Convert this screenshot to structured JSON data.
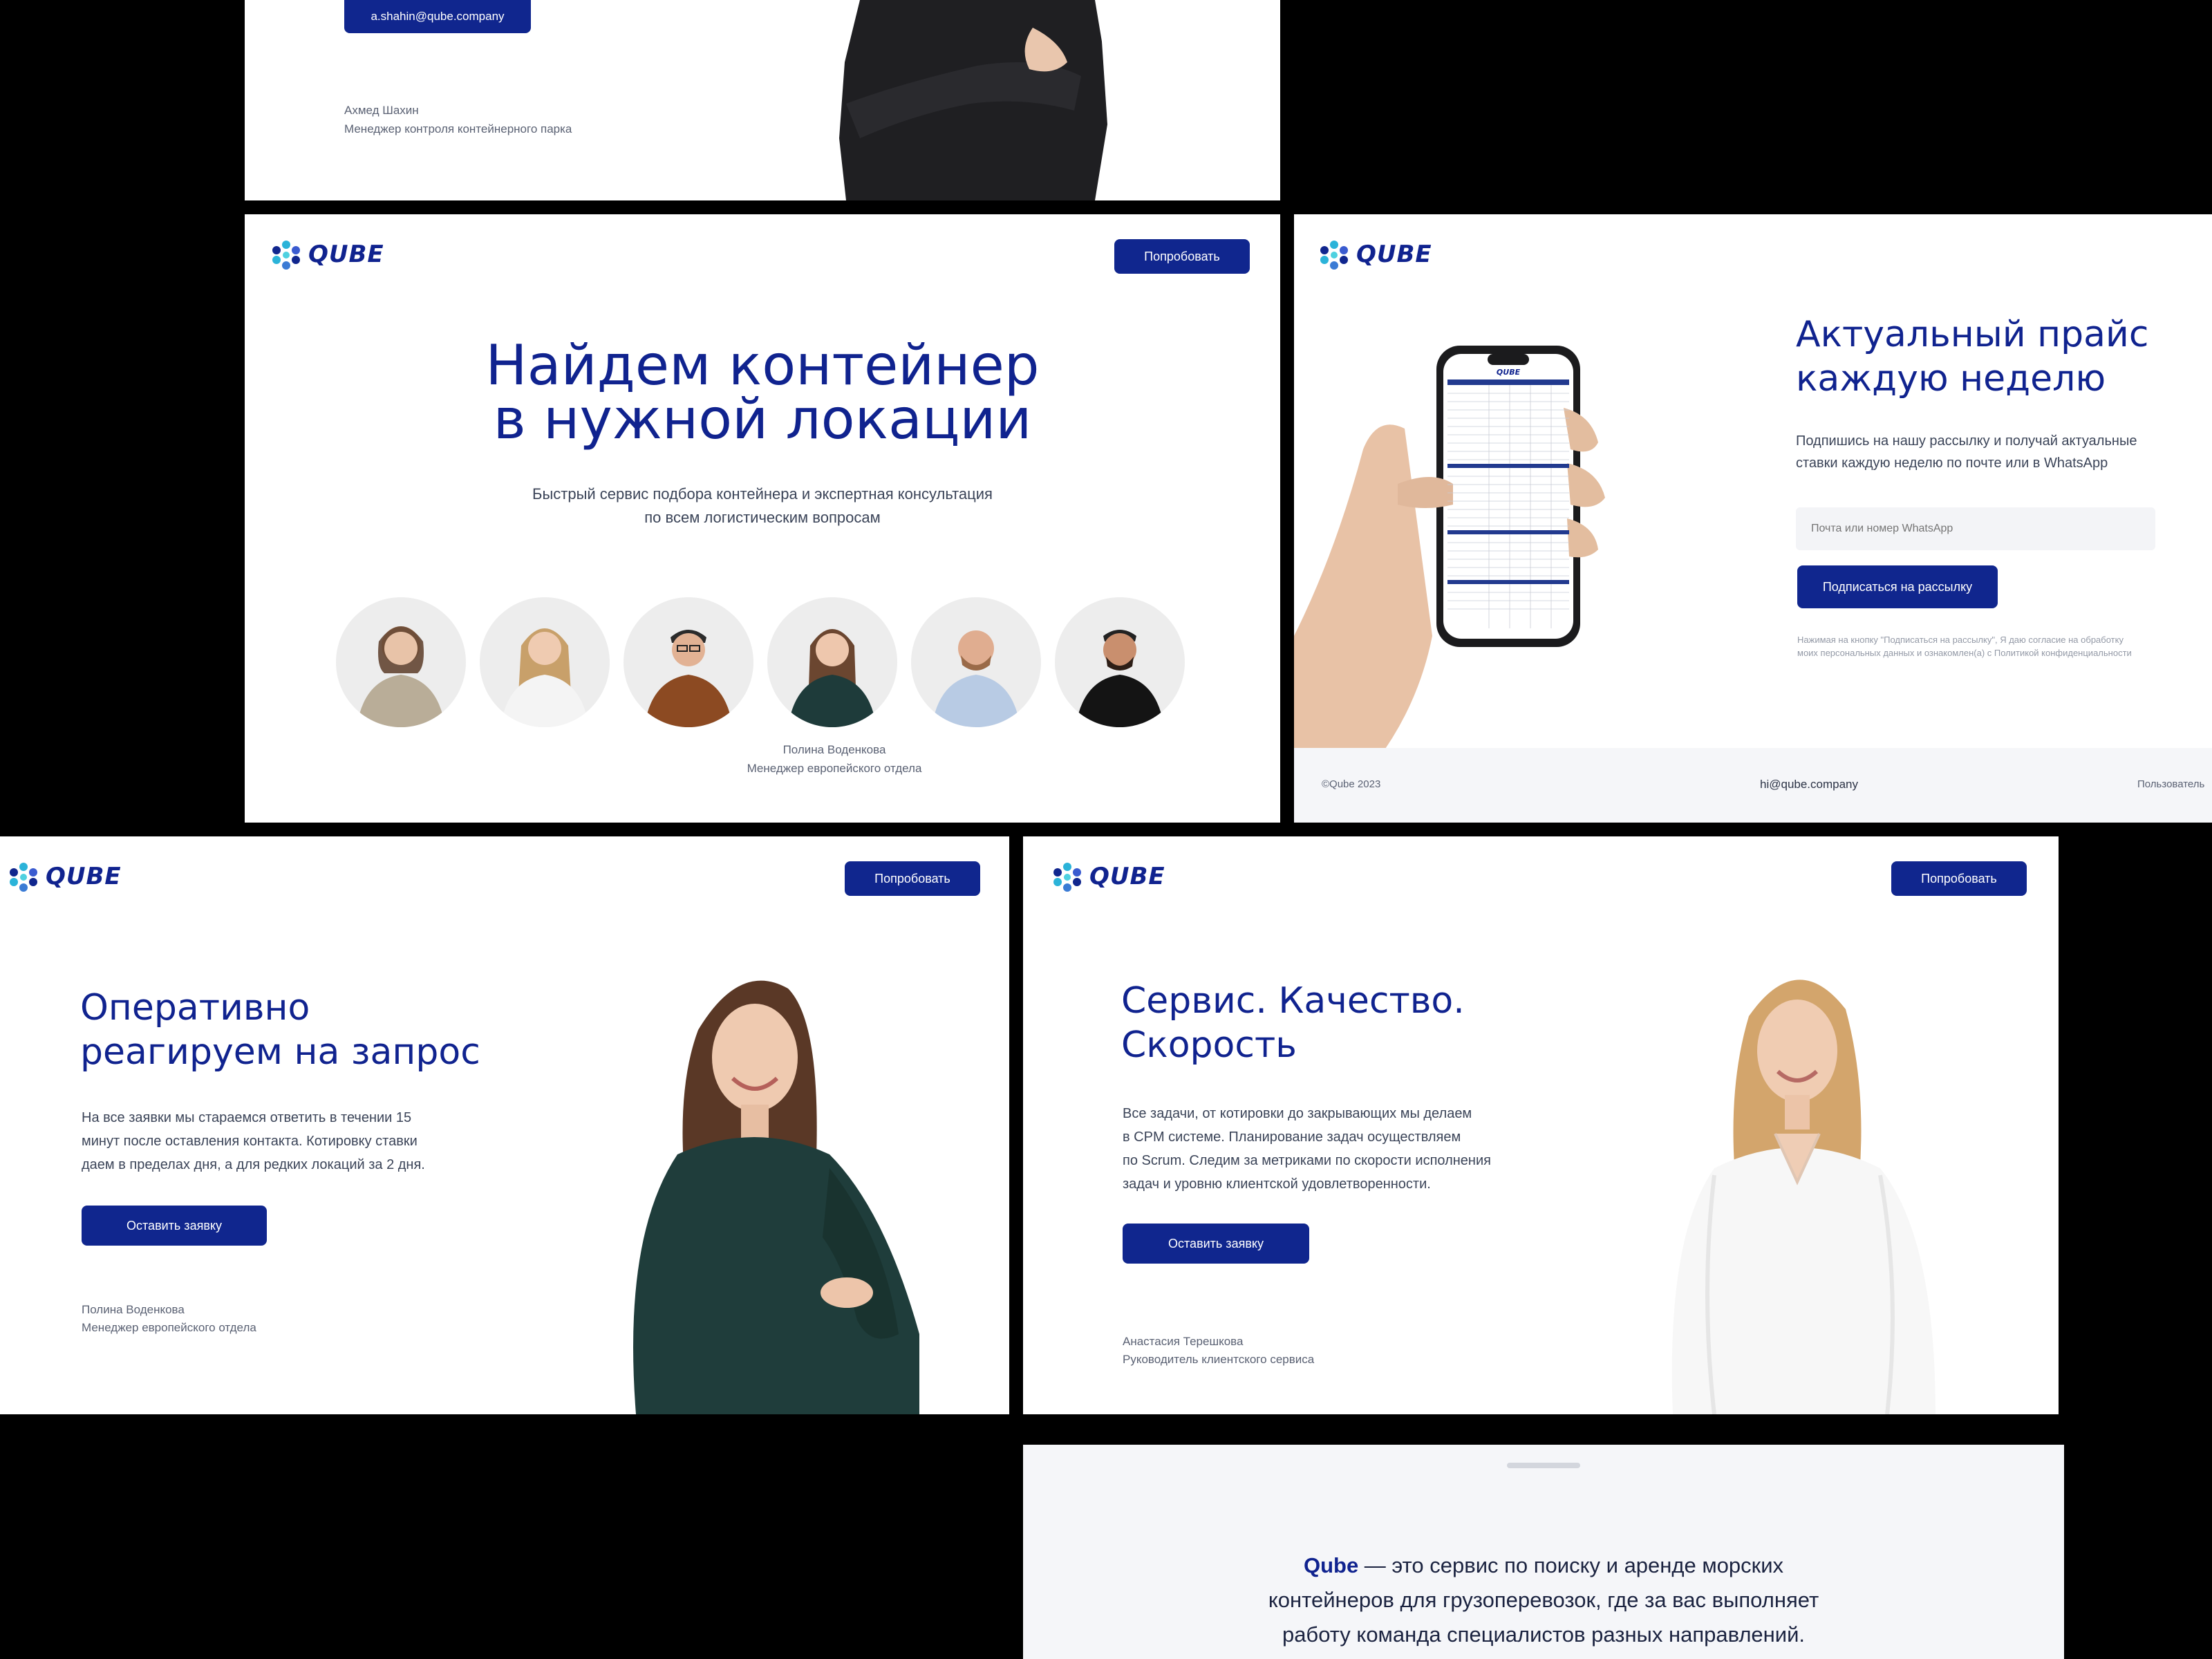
{
  "brand": {
    "name": "QUBE",
    "accent": "#10268e",
    "bg_light": "#f5f6f9"
  },
  "top_card": {
    "email_button": "a.shahin@qube.company",
    "person_name": "Ахмед Шахин",
    "person_role": "Менеджер контроля контейнерного парка"
  },
  "hero": {
    "cta": "Попробовать",
    "title_line1": "Найдем контейнер",
    "title_line2": "в нужной локации",
    "subtitle_line1": "Быстрый сервис подбора контейнера и экспертная консультация",
    "subtitle_line2": "по всем логистическим вопросам",
    "person_name": "Полина Воденкова",
    "person_role": "Менеджер европейского отдела",
    "avatars": [
      "beige",
      "white",
      "brown",
      "green",
      "blue",
      "black"
    ]
  },
  "newsletter": {
    "title_line1": "Актуальный прайс",
    "title_line2": "каждую неделю",
    "text_line1": "Подпишись на нашу рассылку и получай актуальные",
    "text_line2": "ставки каждую неделю по почте или в WhatsApp",
    "input_placeholder": "Почта или номер WhatsApp",
    "button": "Подписаться на рассылку",
    "consent_line1": "Нажимая на кнопку \"Подписаться на рассылку\", Я даю согласие на обработку",
    "consent_line2": "моих персональных данных и ознакомлен(а) с Политикой конфиденциальности",
    "footer_copy": "©Qube 2023",
    "footer_email": "hi@qube.company",
    "footer_link": "Пользователь",
    "phone_logo": "QUBE"
  },
  "fast": {
    "cta": "Попробовать",
    "title_line1": "Оперативно",
    "title_line2": "реагируем на запрос",
    "text_line1": "На все заявки мы стараемся ответить в течении 15",
    "text_line2": "минут после оставления контакта. Котировку ставки",
    "text_line3": "даем в пределах дня, а для редких локаций за 2 дня.",
    "button": "Оставить заявку",
    "person_name": "Полина Воденкова",
    "person_role": "Менеджер европейского отдела"
  },
  "service": {
    "cta": "Попробовать",
    "title_line1": "Сервис. Качество.",
    "title_line2": "Скорость",
    "text_line1": "Все задачи, от котировки до закрывающих мы делаем",
    "text_line2": "в CPM системе. Планирование задач осуществляем",
    "text_line3": "по Scrum. Следим за метриками по скорости исполнения",
    "text_line4": "задач и уровню клиентской удовлетворенности.",
    "button": "Оставить заявку",
    "person_name": "Анастасия Терешкова",
    "person_role": "Руководитель клиентского сервиса"
  },
  "about": {
    "brand_word": "Qube",
    "line1_rest": " — это сервис по поиску и аренде морских",
    "line2": "контейнеров для грузоперевозок, где за вас выполняет",
    "line3": "работу команда специалистов разных направлений."
  }
}
